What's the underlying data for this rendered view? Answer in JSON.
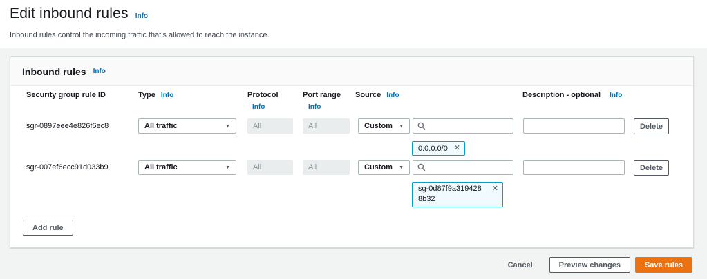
{
  "icons": {
    "caret_down": "▼",
    "dismiss": "✕",
    "search": "search-icon"
  },
  "colors": {
    "accent_orange": "#ec7211",
    "link_blue": "#0073bb",
    "token_border": "#00a1c9",
    "token_bg": "#f1faff",
    "disabled_bg": "#eaeded",
    "border_gray": "#aab7b8",
    "text_dark": "#16191f",
    "page_bg": "#f2f3f3"
  },
  "page": {
    "title": "Edit inbound rules",
    "info": "Info",
    "subtitle": "Inbound rules control the incoming traffic that's allowed to reach the instance."
  },
  "panel": {
    "title": "Inbound rules",
    "info": "Info",
    "columns": {
      "rule_id": "Security group rule ID",
      "type": "Type",
      "protocol": "Protocol",
      "port_range": "Port range",
      "source": "Source",
      "description": "Description - optional",
      "info": "Info"
    },
    "rows": [
      {
        "id": "sgr-0897eee4e826f6ec8",
        "type": "All traffic",
        "protocol": "All",
        "port_range": "All",
        "source_mode": "Custom",
        "source_token": "0.0.0.0/0",
        "delete": "Delete"
      },
      {
        "id": "sgr-007ef6ecc91d033b9",
        "type": "All traffic",
        "protocol": "All",
        "port_range": "All",
        "source_mode": "Custom",
        "source_token": "sg-0d87f9a3194288b32",
        "delete": "Delete"
      }
    ],
    "add_rule": "Add rule"
  },
  "footer": {
    "cancel": "Cancel",
    "preview": "Preview changes",
    "save": "Save rules"
  }
}
